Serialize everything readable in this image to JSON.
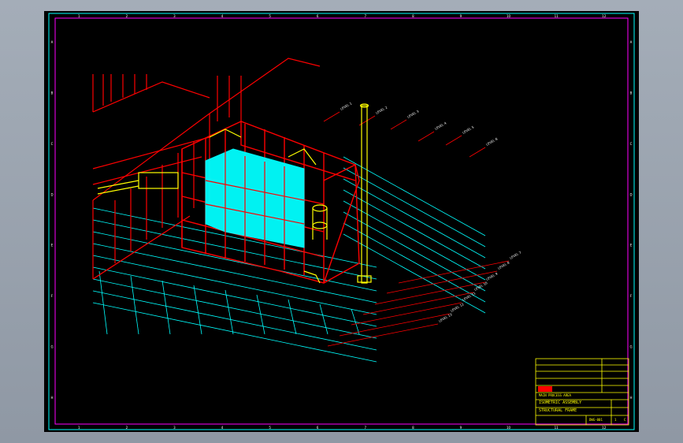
{
  "drawing": {
    "top_zone_numbers": [
      "1",
      "2",
      "3",
      "4",
      "5",
      "6",
      "7",
      "8",
      "9",
      "10",
      "11",
      "12"
    ],
    "side_zone_letters": [
      "A",
      "B",
      "C",
      "D",
      "E",
      "F",
      "G",
      "H"
    ],
    "level_labels_upper": [
      "LEVEL 1",
      "LEVEL 2",
      "LEVEL 3",
      "LEVEL 4",
      "LEVEL 5",
      "LEVEL 6"
    ],
    "level_labels_lower": [
      "LEVEL 7",
      "LEVEL 8",
      "LEVEL 9",
      "LEVEL 10",
      "LEVEL 11",
      "LEVEL 12",
      "LEVEL 13"
    ],
    "colors": {
      "background": "#000000",
      "structure": "#ff0000",
      "equipment": "#00ffff",
      "detail": "#ffff00",
      "border": "#00ffff",
      "frame_inner": "#ff00ff"
    }
  },
  "title_block": {
    "project_line": "MAIN PROCESS AREA",
    "drawing_title_1": "ISOMETRIC ASSEMBLY",
    "drawing_title_2": "STRUCTURAL FRAME",
    "drawing_number": "DWG-001",
    "sheet": "1",
    "rev": "C"
  }
}
